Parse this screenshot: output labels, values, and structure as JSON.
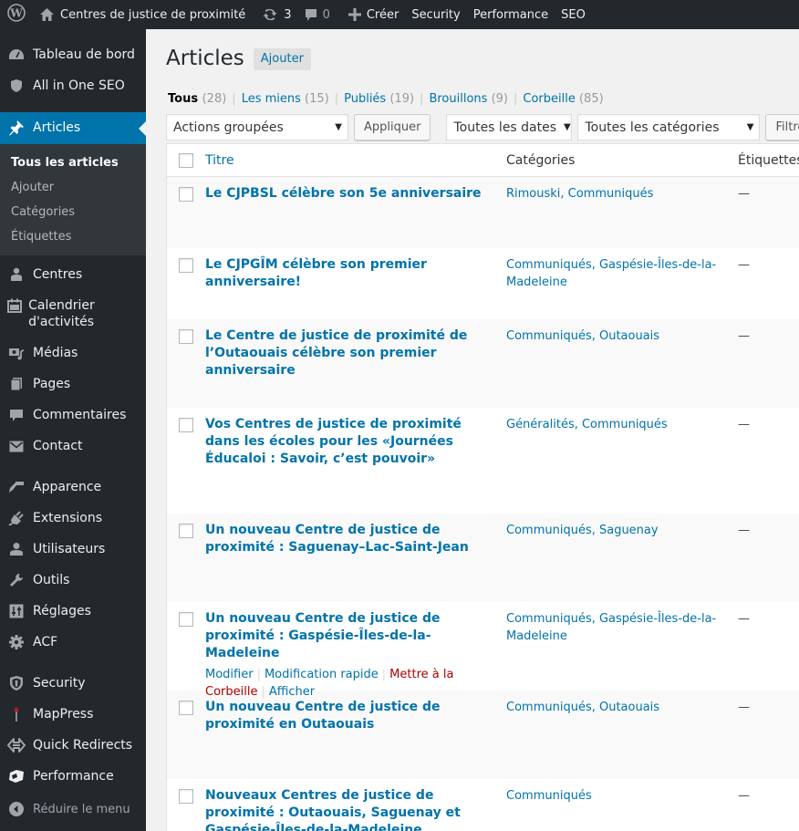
{
  "adminbar": {
    "wp_icon": "wordpress-logo-icon",
    "site_icon": "home-icon",
    "site_name": "Centres de justice de proximité",
    "updates_icon": "refresh-icon",
    "updates_count": "3",
    "comments_icon": "comment-bubble-icon",
    "comments_count": "0",
    "new_icon": "plus-icon",
    "new_label": "Créer",
    "items": [
      "Security",
      "Performance",
      "SEO"
    ]
  },
  "sidebar": {
    "items": [
      {
        "label": "Tableau de bord",
        "icon": "dashboard-gauge-icon"
      },
      {
        "label": "All in One SEO",
        "icon": "shield-icon"
      },
      {
        "label": "Articles",
        "icon": "pushpin-icon",
        "active": true
      },
      {
        "label": "Centres",
        "icon": "person-tie-icon"
      },
      {
        "label": "Calendrier d'activités",
        "icon": "calendar-icon"
      },
      {
        "label": "Médias",
        "icon": "media-camera-music-icon"
      },
      {
        "label": "Pages",
        "icon": "pages-icon"
      },
      {
        "label": "Commentaires",
        "icon": "comment-icon"
      },
      {
        "label": "Contact",
        "icon": "envelope-icon"
      },
      {
        "label": "Apparence",
        "icon": "paintbrush-icon"
      },
      {
        "label": "Extensions",
        "icon": "plugin-icon"
      },
      {
        "label": "Utilisateurs",
        "icon": "user-icon"
      },
      {
        "label": "Outils",
        "icon": "wrench-icon"
      },
      {
        "label": "Réglages",
        "icon": "settings-sliders-icon"
      },
      {
        "label": "ACF",
        "icon": "gear-icon"
      },
      {
        "label": "Security",
        "icon": "security-shield-icon"
      },
      {
        "label": "MapPress",
        "icon": "map-pin-icon"
      },
      {
        "label": "Quick Redirects",
        "icon": "redirect-arrows-icon"
      },
      {
        "label": "Performance",
        "icon": "performance-cube-icon"
      }
    ],
    "submenu": [
      {
        "label": "Tous les articles",
        "current": true
      },
      {
        "label": "Ajouter"
      },
      {
        "label": "Catégories"
      },
      {
        "label": "Étiquettes"
      }
    ],
    "collapse_label": "Réduire le menu",
    "collapse_icon": "collapse-arrow-icon"
  },
  "main": {
    "title": "Articles",
    "add_new": "Ajouter",
    "views": [
      {
        "label": "Tous",
        "count": "(28)",
        "current": true
      },
      {
        "label": "Les miens",
        "count": "(15)"
      },
      {
        "label": "Publiés",
        "count": "(19)"
      },
      {
        "label": "Brouillons",
        "count": "(9)"
      },
      {
        "label": "Corbeille",
        "count": "(85)"
      }
    ],
    "bulk_actions": "Actions groupées",
    "apply": "Appliquer",
    "date_filter": "Toutes les dates",
    "category_filter": "Toutes les catégories",
    "filter_button": "Filtrer",
    "columns": {
      "title": "Titre",
      "categories": "Catégories",
      "tags": "Étiquettes"
    },
    "rows": [
      {
        "title": "Le CJPBSL célèbre son 5e anniversaire",
        "categories": "Rimouski, Communiqués",
        "tags": "—"
      },
      {
        "title": "Le CJPGÎM célèbre son premier anniversaire!",
        "categories": "Communiqués, Gaspésie-Îles-de-la-Madeleine",
        "tags": "—"
      },
      {
        "title": "Le Centre de justice de proximité de l’Outaouais célèbre son premier anniversaire",
        "categories": "Communiqués, Outaouais",
        "tags": "—"
      },
      {
        "title": "Vos Centres de justice de proximité dans les écoles pour les «Journées Éducaloi : Savoir, c’est pouvoir»",
        "categories": "Généralités, Communiqués",
        "tags": "—"
      },
      {
        "title": "Un nouveau Centre de justice de proximité : Saguenay–Lac-Saint-Jean",
        "categories": "Communiqués, Saguenay",
        "tags": "—"
      },
      {
        "title": "Un nouveau Centre de justice de proximité : Gaspésie-Îles-de-la-Madeleine",
        "categories": "Communiqués, Gaspésie-Îles-de-la-Madeleine",
        "tags": "—",
        "hover": true
      },
      {
        "title": "Un nouveau Centre de justice de proximité en Outaouais",
        "categories": "Communiqués, Outaouais",
        "tags": "—"
      },
      {
        "title": "Nouveaux Centres de justice de proximité : Outaouais, Saguenay et Gaspésie-Îles-de-la-Madeleine",
        "categories": "Communiqués",
        "tags": "—"
      }
    ],
    "row_actions": {
      "edit": "Modifier",
      "quick_edit": "Modification rapide",
      "trash": "Mettre à la Corbeille",
      "view": "Afficher"
    }
  },
  "colors": {
    "adminbar_bg": "#23282d",
    "sidebar_bg": "#23282d",
    "submenu_bg": "#32373c",
    "accent": "#0073aa",
    "trash": "#a00",
    "page_bg": "#f1f1f1"
  }
}
